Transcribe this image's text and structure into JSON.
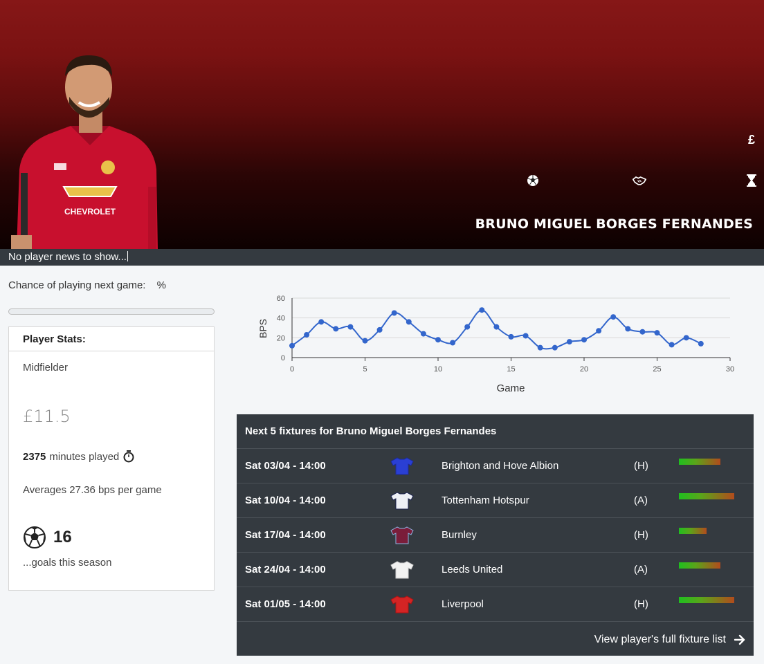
{
  "player": {
    "name": "BRUNO MIGUEL BORGES FERNANDES",
    "news": "No player news to show...",
    "chance_label": "Chance of playing next game:",
    "chance_value": "",
    "chance_unit": "%",
    "chance_progress": 0
  },
  "hero_icons": {
    "price_symbol": "£"
  },
  "stats": {
    "header": "Player Stats:",
    "position": "Midfielder",
    "price": "£11.5",
    "minutes": "2375",
    "minutes_label": "minutes played",
    "averages": "Averages 27.36 bps per game",
    "goals": "16",
    "goals_label": "...goals this season"
  },
  "chart_data": {
    "type": "line",
    "xlabel": "Game",
    "ylabel": "BPS",
    "xlim": [
      0,
      30
    ],
    "ylim": [
      0,
      60
    ],
    "xticks": [
      "0",
      "5",
      "10",
      "15",
      "20",
      "25",
      "30"
    ],
    "yticks": [
      "0",
      "20",
      "40",
      "60"
    ],
    "grid": true,
    "color": "#3366cc",
    "series": [
      {
        "x": [
          0,
          1,
          2,
          3,
          4,
          5,
          6,
          7,
          8,
          9,
          10,
          11,
          12,
          13,
          14,
          15,
          16,
          17,
          18,
          19,
          20,
          21,
          22,
          23,
          24,
          25,
          26,
          27,
          28
        ],
        "values": [
          12,
          23,
          36,
          29,
          31,
          17,
          28,
          45,
          36,
          24,
          18,
          15,
          31,
          48,
          31,
          21,
          22,
          10,
          10,
          16,
          18,
          27,
          41,
          29,
          26,
          25,
          13,
          20,
          14
        ]
      }
    ]
  },
  "fixtures": {
    "title": "Next 5 fixtures for Bruno Miguel Borges Fernandes",
    "rows": [
      {
        "date": "Sat 03/04 - 14:00",
        "team": "Brighton and Hove Albion",
        "venue": "(H)",
        "shirt_color": "#2a3fd4",
        "shirt_trim": "#1b2a9a",
        "difficulty": 3
      },
      {
        "date": "Sat 10/04 - 14:00",
        "team": "Tottenham Hotspur",
        "venue": "(A)",
        "shirt_color": "#eef0f6",
        "shirt_trim": "#1b2250",
        "difficulty": 4
      },
      {
        "date": "Sat 17/04 - 14:00",
        "team": "Burnley",
        "venue": "(H)",
        "shirt_color": "#7a1d3a",
        "shirt_trim": "#8fb3e0",
        "difficulty": 2
      },
      {
        "date": "Sat 24/04 - 14:00",
        "team": "Leeds United",
        "venue": "(A)",
        "shirt_color": "#f2f2f2",
        "shirt_trim": "#cfcfcf",
        "difficulty": 3
      },
      {
        "date": "Sat 01/05 - 14:00",
        "team": "Liverpool",
        "venue": "(H)",
        "shirt_color": "#d42424",
        "shirt_trim": "#a81414",
        "difficulty": 4
      }
    ],
    "footer_link": "View player's full fixture list"
  }
}
